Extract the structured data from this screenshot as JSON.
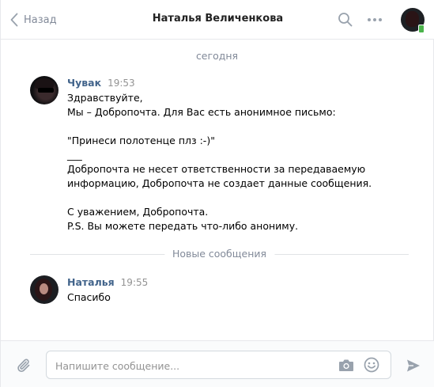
{
  "header": {
    "back_label": "Назад",
    "title": "Наталья Величенкова"
  },
  "date_divider": "сегодня",
  "messages": [
    {
      "author": "Чувак",
      "time": "19:53",
      "lines": [
        "Здравствуйте,",
        "Мы – Добропочта. Для Вас есть анонимное письмо:",
        "",
        "\"Принеси полотенце плз :-)\"",
        "___",
        "Добропочта не несет ответственности за передаваемую",
        "информацию, Добропочта не создает данные сообщения.",
        "",
        "С уважением, Добропочта.",
        "P.S. Вы можете передать что-либо анониму."
      ]
    },
    {
      "author": "Наталья",
      "time": "19:55",
      "text": "Спасибо"
    }
  ],
  "new_messages_divider": "Новые сообщения",
  "composer": {
    "placeholder": "Напишите сообщение...",
    "value": ""
  },
  "colors": {
    "accent": "#42648b",
    "muted": "#828a99",
    "online": "#4bb34b"
  },
  "icons": [
    "chevron-left-icon",
    "search-icon",
    "more-icon",
    "attach-icon",
    "camera-icon",
    "smile-icon",
    "send-icon"
  ]
}
